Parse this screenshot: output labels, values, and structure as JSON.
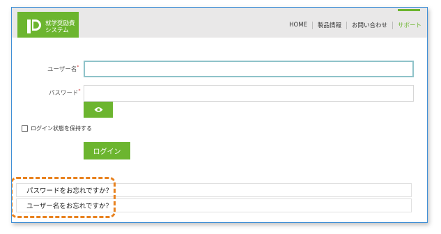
{
  "header": {
    "logo_line1": "就学奨励費",
    "logo_line2": "システム",
    "nav": [
      {
        "label": "HOME"
      },
      {
        "label": "製品情報"
      },
      {
        "label": "お問い合わせ"
      },
      {
        "label": "サポート"
      }
    ],
    "accent_color": "#6cb52f"
  },
  "form": {
    "username_label": "ユーザー名",
    "password_label": "パスワード",
    "required_mark": "*",
    "username_value": "",
    "password_value": "",
    "show_password_icon": "eye-icon",
    "remember_label": "ログイン状態を保持する",
    "login_button": "ログイン"
  },
  "links": {
    "forgot_password": "パスワードをお忘れですか？",
    "forgot_username": "ユーザー名をお忘れですか？"
  },
  "annotation_color": "#e8821f"
}
